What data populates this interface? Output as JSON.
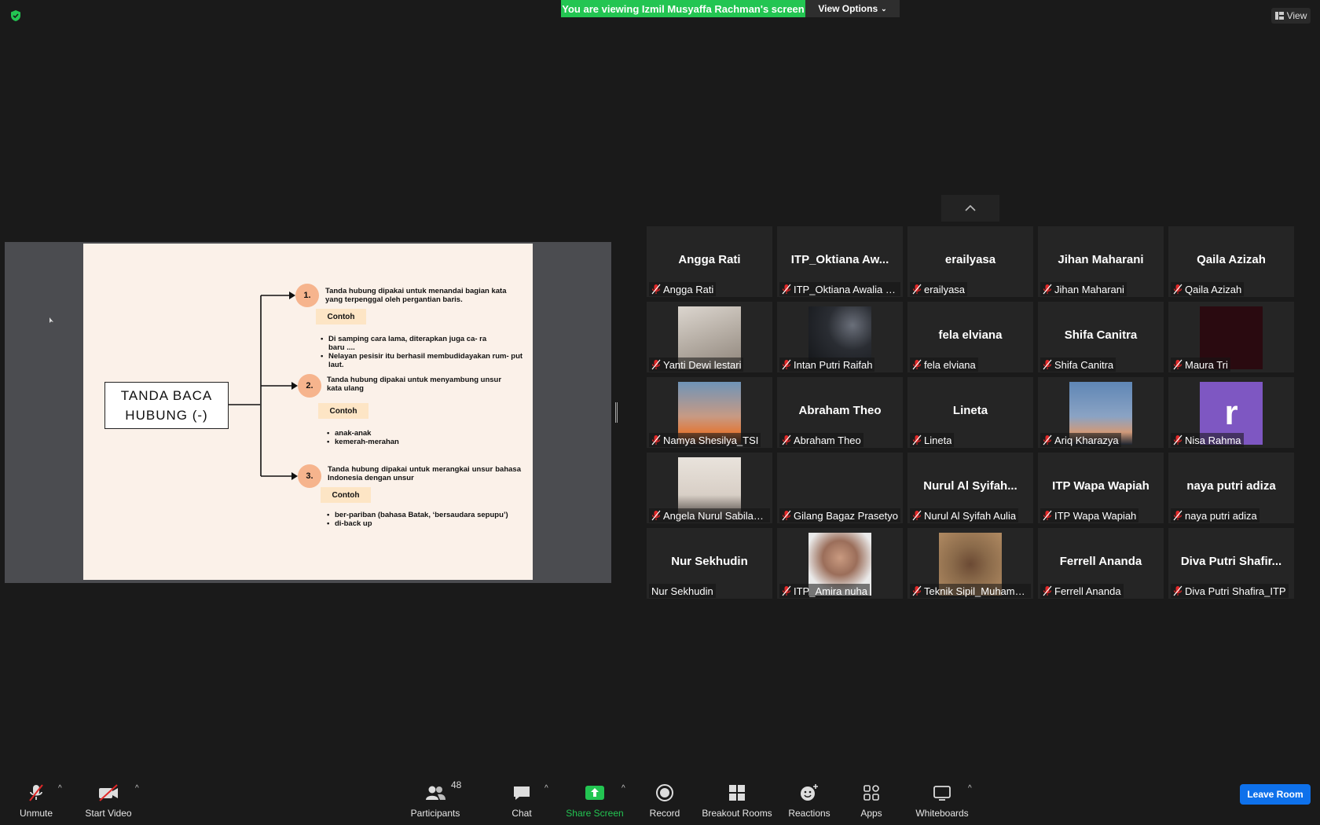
{
  "banner": {
    "viewing": "You are viewing Izmil Musyaffa Rachman's screen",
    "view_options": "View Options",
    "view": "View"
  },
  "slide": {
    "title": "TANDA BACA HUBUNG (-)",
    "items": [
      {
        "num": "1.",
        "desc": "Tanda hubung dipakai untuk menandai bagian kata yang terpenggal oleh pergantian baris.",
        "contoh": "Contoh",
        "examples": [
          "Di samping cara lama, diterapkan juga ca- ra baru ....",
          "Nelayan pesisir itu berhasil membudidayakan rum- put laut."
        ]
      },
      {
        "num": "2.",
        "desc": "Tanda hubung dipakai untuk menyambung unsur kata ulang",
        "contoh": "Contoh",
        "examples": [
          "anak-anak",
          "kemerah-merahan"
        ]
      },
      {
        "num": "3.",
        "desc": "Tanda hubung dipakai untuk merangkai unsur bahasa Indonesia dengan unsur",
        "contoh": "Contoh",
        "examples": [
          "ber-pariban (bahasa Batak, ‘bersaudara sepupu’)",
          "di-back up"
        ]
      }
    ]
  },
  "participants": [
    {
      "tile_name": "Angga Rati",
      "label": "Angga Rati"
    },
    {
      "tile_name": "ITP_Oktiana Aw...",
      "label": "ITP_Oktiana Awalia Sy..."
    },
    {
      "tile_name": "erailyasa",
      "label": "erailyasa"
    },
    {
      "tile_name": "Jihan Maharani",
      "label": "Jihan Maharani"
    },
    {
      "tile_name": "Qaila Azizah",
      "label": "Qaila Azizah"
    },
    {
      "photo": "photo-selfie-mirror",
      "label": "Yanti Dewi lestari"
    },
    {
      "photo": "photo-night-city",
      "label": "Intan Putri Raifah"
    },
    {
      "tile_name": "fela elviana",
      "label": "fela elviana"
    },
    {
      "tile_name": "Shifa Canitra",
      "label": "Shifa Canitra"
    },
    {
      "photo": "photo-dark-red",
      "label": "Maura Tri"
    },
    {
      "photo": "photo-sunset-sky",
      "label": "Namya Shesilya_TSI"
    },
    {
      "tile_name": "Abraham Theo",
      "label": "Abraham Theo"
    },
    {
      "tile_name": "Lineta",
      "label": "Lineta"
    },
    {
      "photo": "photo-dusk-tree",
      "label": "Ariq Kharazya"
    },
    {
      "avatar_letter": "r",
      "label": "Nisa Rahma"
    },
    {
      "photo": "photo-selfie-room",
      "label": "Angela Nurul Sabila_I..."
    },
    {
      "label": "Gilang Bagaz Prasetyo"
    },
    {
      "tile_name": "Nurul Al Syifah...",
      "label": "Nurul Al Syifah Aulia"
    },
    {
      "tile_name": "ITP Wapa Wapiah",
      "label": "ITP Wapa Wapiah"
    },
    {
      "tile_name": "naya putri adiza",
      "label": "naya putri adiza"
    },
    {
      "tile_name": "Nur Sekhudin",
      "label": "Nur Sekhudin",
      "unmuted": true
    },
    {
      "photo": "photo-portrait-woman",
      "label": "ITP_Amira nuha"
    },
    {
      "photo": "photo-portrait-man",
      "label": "Teknik Sipil_Muhamm..."
    },
    {
      "tile_name": "Ferrell Ananda",
      "label": "Ferrell Ananda"
    },
    {
      "tile_name": "Diva Putri Shafir...",
      "label": "Diva Putri Shafira_ITP"
    }
  ],
  "toolbar": {
    "unmute": "Unmute",
    "start_video": "Start Video",
    "participants": "Participants",
    "participants_count": "48",
    "chat": "Chat",
    "share_screen": "Share Screen",
    "record": "Record",
    "breakout_rooms": "Breakout Rooms",
    "reactions": "Reactions",
    "apps": "Apps",
    "whiteboards": "Whiteboards",
    "leave_room": "Leave Room"
  },
  "colors": {
    "accent_green": "#23c552",
    "leave_blue": "#0e71eb",
    "muted_red": "#e02828",
    "slide_bg": "#fbf1e9",
    "number_circle": "#f6b48d",
    "contoh_bg": "#fde5c5"
  }
}
